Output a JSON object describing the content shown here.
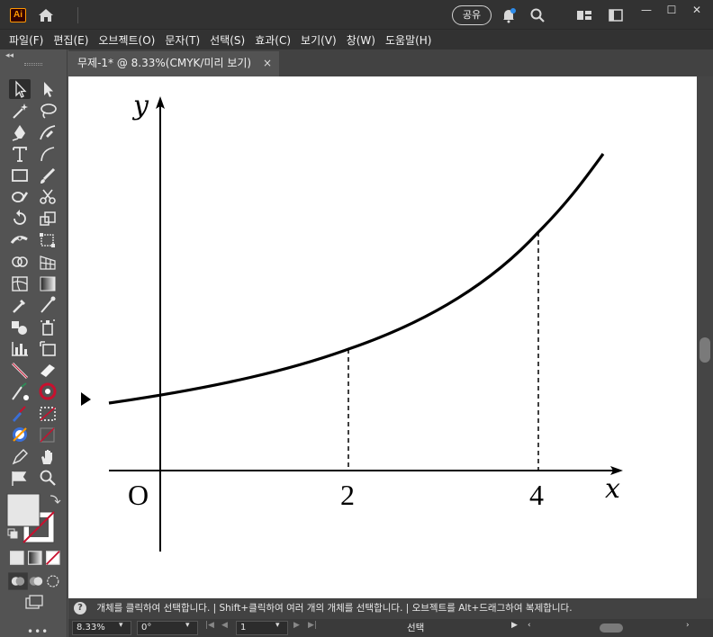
{
  "app": {
    "logo_text": "Ai",
    "share_label": "공유",
    "minimize": "—",
    "maximize": "☐",
    "close": "✕"
  },
  "menu": [
    "파일(F)",
    "편집(E)",
    "오브젝트(O)",
    "문자(T)",
    "선택(S)",
    "효과(C)",
    "보기(V)",
    "창(W)",
    "도움말(H)"
  ],
  "document": {
    "tab_label": "무제-1* @ 8.33%(CMYK/미리 보기)",
    "close_label": "×"
  },
  "graph": {
    "y_label": "y",
    "x_label": "x",
    "origin_label": "O",
    "tick_labels": [
      "2",
      "4"
    ],
    "curve_color": "#000000"
  },
  "hint": {
    "help_glyph": "?",
    "text": "개체를 클릭하여 선택합니다. | Shift+클릭하여 여러 개의 개체를 선택합니다. | 오브젝트를 Alt+드래그하여 복제합니다."
  },
  "status": {
    "zoom": "8.33%",
    "rotation": "0°",
    "artboard": "1",
    "tool_name": "선택"
  },
  "colors": {
    "accent": "#ff9a00",
    "fill_swatch": "#e6e6e6",
    "stroke_none": "#c8102e"
  }
}
